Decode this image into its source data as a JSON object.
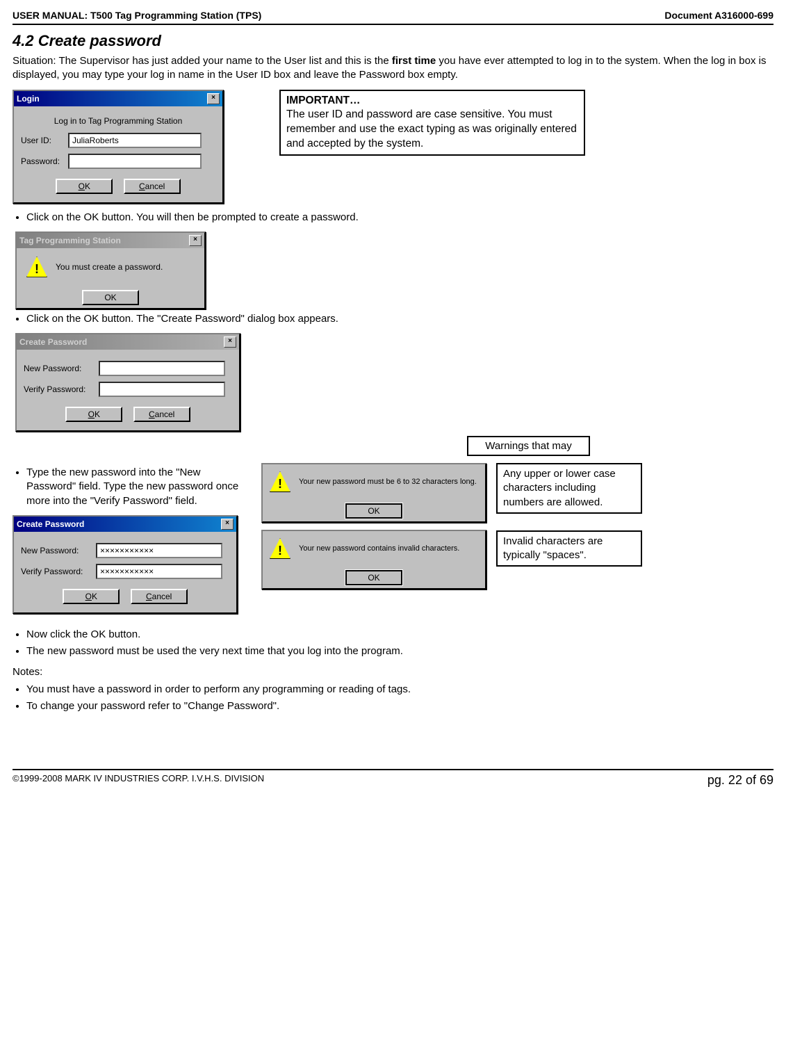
{
  "header": {
    "left": "USER MANUAL: T500 Tag Programming Station (TPS)",
    "right": "Document A316000-699"
  },
  "section": {
    "title": "4.2 Create password",
    "intro_pre": "Situation: The Supervisor has just added your name to the User list and this is the ",
    "intro_bold": "first time",
    "intro_post": " you have ever attempted to log in to the system. When the log in box is displayed, you may type your log in name in the User ID box and leave the Password box empty."
  },
  "important_box": {
    "title": "IMPORTANT…",
    "body": "The user ID and password are case sensitive. You must remember and use the exact typing as was originally entered and accepted by the system."
  },
  "login_dialog": {
    "title": "Login",
    "subtitle": "Log in to Tag Programming Station",
    "user_label": "User ID:",
    "user_value": "JuliaRoberts",
    "pass_label": "Password:",
    "ok": "OK",
    "cancel": "Cancel"
  },
  "bullets1": [
    "Click on the OK button. You will then be prompted to create a password."
  ],
  "msg_dialog1": {
    "title": "Tag Programming Station",
    "message": "You must create a password.",
    "ok": "OK"
  },
  "bullets2": [
    "Click on the OK button. The \"Create Password\" dialog box appears."
  ],
  "create_dialog": {
    "title": "Create Password",
    "new_label": "New Password:",
    "verify_label": "Verify Password:",
    "ok": "OK",
    "cancel": "Cancel",
    "masked": "×××××××××××"
  },
  "warnings_label": "Warnings that may",
  "bullet_type": "Type the new password into the \"New Password\" field. Type the new password once more into the \"Verify Password\" field.",
  "warn_msg1": {
    "message": "Your new password must be 6 to 32 characters long.",
    "ok": "OK"
  },
  "warn_msg2": {
    "message": "Your new password contains invalid characters.",
    "ok": "OK"
  },
  "callout1": "Any upper or lower case characters including numbers are allowed.",
  "callout2": "Invalid characters are typically \"spaces\".",
  "bullets3": [
    "Now click the OK button.",
    "The new password must be used the very next time that you log into the program."
  ],
  "notes_label": "Notes:",
  "notes": [
    "You must have a password in order to perform any programming or reading of tags.",
    "To change your password refer to \"Change Password\"."
  ],
  "footer": {
    "left": "©1999-2008 MARK IV INDUSTRIES CORP. I.V.H.S. DIVISION",
    "right": "pg. 22 of 69"
  }
}
